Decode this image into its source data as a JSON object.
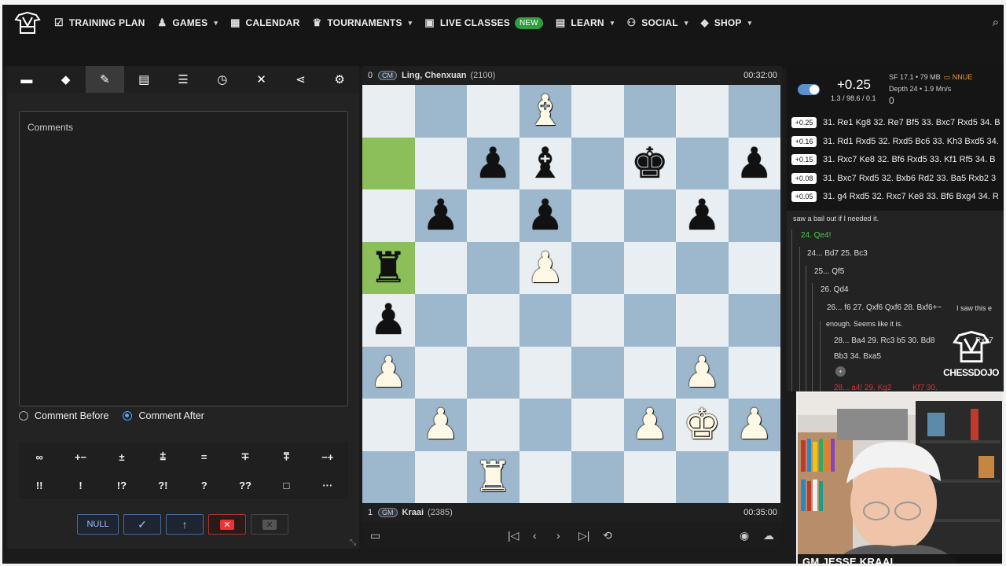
{
  "nav": {
    "items": [
      {
        "label": "TRAINING PLAN",
        "icon": "checklist-icon",
        "chev": false
      },
      {
        "label": "GAMES",
        "icon": "pawn-icon",
        "chev": true
      },
      {
        "label": "CALENDAR",
        "icon": "calendar-icon",
        "chev": false
      },
      {
        "label": "TOURNAMENTS",
        "icon": "trophy-icon",
        "chev": true
      },
      {
        "label": "LIVE CLASSES",
        "icon": "live-icon",
        "chev": false,
        "badge": "NEW"
      },
      {
        "label": "LEARN",
        "icon": "book-icon",
        "chev": true
      },
      {
        "label": "SOCIAL",
        "icon": "users-icon",
        "chev": true
      },
      {
        "label": "SHOP",
        "icon": "tag-icon",
        "chev": true
      }
    ]
  },
  "comment_panel": {
    "placeholder": "Comments",
    "radio_before": "Comment Before",
    "radio_after": "Comment After",
    "selected": "after",
    "glyphs_row1": [
      "∞",
      "+−",
      "±",
      "⩲",
      "=",
      "∓",
      "⩱",
      "−+"
    ],
    "glyphs_row2": [
      "!!",
      "!",
      "!?",
      "?!",
      "?",
      "??",
      "□",
      "···"
    ],
    "null_label": "NULL"
  },
  "top_player": {
    "index": "0",
    "title": "CM",
    "name": "Ling, Chenxuan",
    "rating": "(2100)",
    "clock": "00:32:00"
  },
  "bottom_player": {
    "index": "1",
    "title": "GM",
    "name": "Kraai",
    "rating": "(2385)",
    "clock": "00:35:00"
  },
  "board": {
    "rows": [
      [
        "",
        "",
        "",
        "wB",
        "",
        "",
        "",
        ""
      ],
      [
        "",
        "",
        "bP",
        "bB",
        "",
        "bK",
        "",
        "bP"
      ],
      [
        "",
        "bP",
        "",
        "bP",
        "",
        "",
        "bP",
        ""
      ],
      [
        "bR",
        "",
        "",
        "wP",
        "",
        "",
        "",
        ""
      ],
      [
        "bP",
        "",
        "",
        "",
        "",
        "",
        "",
        ""
      ],
      [
        "wP",
        "",
        "",
        "",
        "",
        "",
        "wP",
        ""
      ],
      [
        "",
        "wP",
        "",
        "",
        "",
        "wP",
        "wK",
        "wP"
      ],
      [
        "",
        "",
        "wR",
        "",
        "",
        "",
        "",
        ""
      ]
    ],
    "highlights": [
      "a7",
      "a5"
    ]
  },
  "engine": {
    "eval": "+0.25",
    "wdl": "1.3 / 98.6 / 0.1",
    "name": "SF 17.1 • 79 MB",
    "nnue": "NNUE",
    "depth": "Depth 24 • 1.9 Mn/s",
    "zero": "0",
    "lines": [
      {
        "eval": "+0.25",
        "moves": "31. Re1 Kg8 32. Re7 Bf5 33. Bxc7 Rxd5 34. B"
      },
      {
        "eval": "+0.16",
        "moves": "31. Rd1 Rxd5 32. Rxd5 Bc6 33. Kh3 Bxd5 34."
      },
      {
        "eval": "+0.15",
        "moves": "31. Rxc7 Ke8 32. Bf6 Rxd5 33. Kf1 Rf5 34. B"
      },
      {
        "eval": "+0.08",
        "moves": "31. Bxc7 Rxd5 32. Bxb6 Rd2 33. Ba5 Rxb2 3"
      },
      {
        "eval": "+0.05",
        "moves": "31. g4 Rxd5 32. Rxc7 Ke8 33. Bf6 Bxg4 34. R"
      }
    ]
  },
  "movetree": {
    "l1": "saw a bail out if I needed it.",
    "l2": "24. Qe4!",
    "l3": "24... Bd7 25. Bc3",
    "l4": "25... Qf5",
    "l5": "26. Qd4",
    "l6": "26... f6 27. Qxf6 Qxf6 28. Bxf6+−",
    "l6c": "I saw this e",
    "l7": "enough. Seems like it is.",
    "l8": "28... Ba4 29. Rc3 b5 30. Bd8",
    "l8b": "Rxc7",
    "l9": "Bb3 34. Bxa5",
    "l10": "28... a4! 29. Kg2",
    "l10b": "Kf7 30.",
    "logo_text": "CHESSDOJO"
  },
  "webcam": {
    "label": "GM JESSE KRAAI"
  }
}
